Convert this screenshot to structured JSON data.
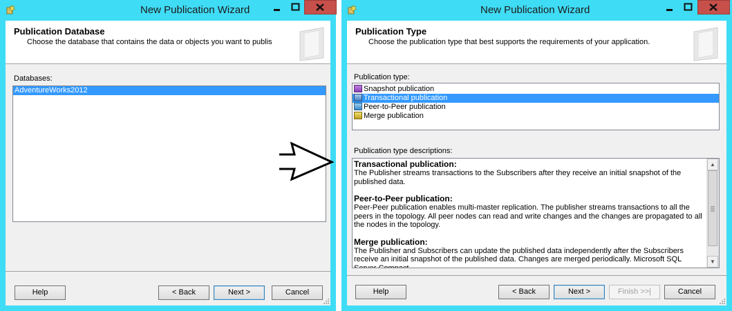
{
  "window1": {
    "title": "New Publication Wizard",
    "header": {
      "title": "Publication Database",
      "description": "Choose the database that contains the data or objects you want to publis"
    },
    "databases_label": "Databases:",
    "databases": [
      "AdventureWorks2012"
    ],
    "buttons": {
      "help": "Help",
      "back": "< Back",
      "next": "Next >",
      "cancel": "Cancel"
    }
  },
  "window2": {
    "title": "New Publication Wizard",
    "header": {
      "title": "Publication Type",
      "description": "Choose the publication type that best supports the requirements of your application."
    },
    "publication_type_label": "Publication type:",
    "publication_types": [
      {
        "label": "Snapshot publication",
        "icon": "snapshot-publication-icon",
        "selected": false
      },
      {
        "label": "Transactional publication",
        "icon": "transactional-publication-icon",
        "selected": true
      },
      {
        "label": "Peer-to-Peer publication",
        "icon": "peer-to-peer-publication-icon",
        "selected": false
      },
      {
        "label": "Merge publication",
        "icon": "merge-publication-icon",
        "selected": false
      }
    ],
    "descriptions_label": "Publication type descriptions:",
    "descriptions": [
      {
        "heading": "Transactional publication:",
        "text": "The Publisher streams transactions to the Subscribers after they receive an initial snapshot of the published data."
      },
      {
        "heading": "Peer-to-Peer publication:",
        "text": "Peer-Peer publication enables multi-master replication. The publisher streams transactions to all the peers in the topology. All peer nodes can read and write changes and the changes are propagated to all the nodes in the topology."
      },
      {
        "heading": "Merge publication:",
        "text": "The Publisher and Subscribers can update the published data independently after the Subscribers receive an initial snapshot of the published data. Changes are merged periodically. Microsoft SQL Server Compact"
      }
    ],
    "buttons": {
      "help": "Help",
      "back": "< Back",
      "next": "Next >",
      "finish": "Finish >>|",
      "cancel": "Cancel"
    }
  },
  "colors": {
    "frame": "#3fdcf5",
    "close": "#c7504b",
    "selection": "#3399ff"
  }
}
